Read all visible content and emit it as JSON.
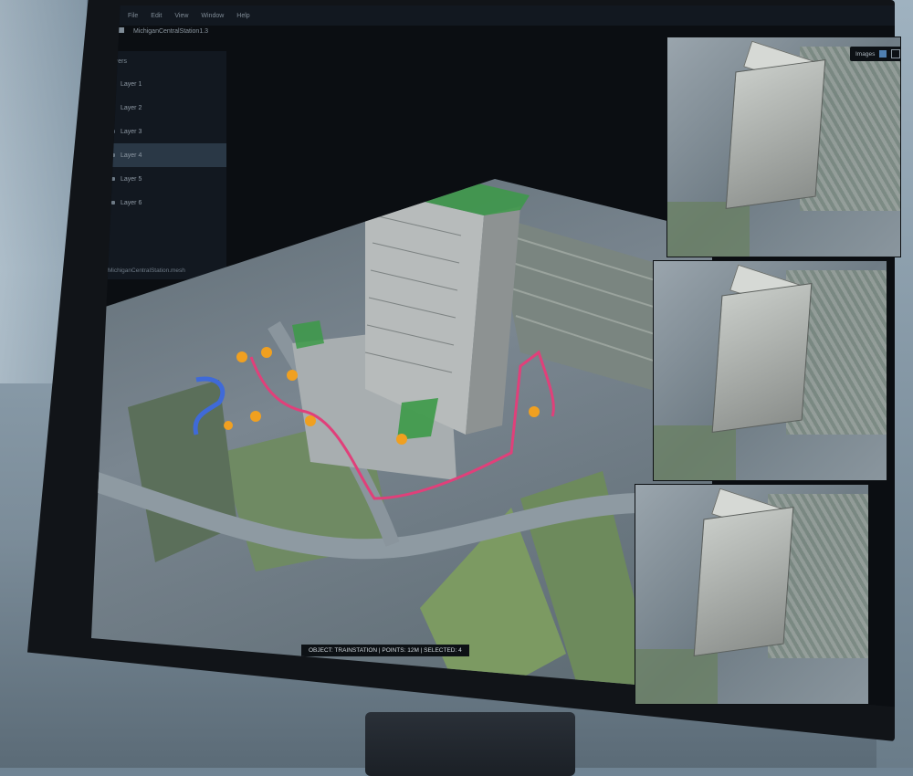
{
  "menu": {
    "items": [
      "File",
      "Edit",
      "View",
      "Window",
      "Help"
    ]
  },
  "window": {
    "title": "MichiganCentralStation1.3"
  },
  "sidebar": {
    "title": "Layers",
    "layers": [
      {
        "label": "Layer 1",
        "selected": false
      },
      {
        "label": "Layer 2",
        "selected": false
      },
      {
        "label": "Layer 3",
        "selected": false
      },
      {
        "label": "Layer 4",
        "selected": true
      },
      {
        "label": "Layer 5",
        "selected": false
      },
      {
        "label": "Layer 6",
        "selected": false
      }
    ],
    "footer": "MichiganCentralStation.mesh"
  },
  "viewport": {
    "status": "OBJECT: TRAINSTATION | POINTS: 12M | SELECTED: 4",
    "route_color": "#e0407a",
    "marker_color": "#f0a020",
    "highlight_color": "#3c9a48"
  },
  "tools": [
    "pencil-icon",
    "hand-icon",
    "crop-icon",
    "pin-icon"
  ],
  "right_panel": {
    "toggle_label": "Images",
    "images": [
      "image-1",
      "image-2",
      "image-3"
    ]
  }
}
